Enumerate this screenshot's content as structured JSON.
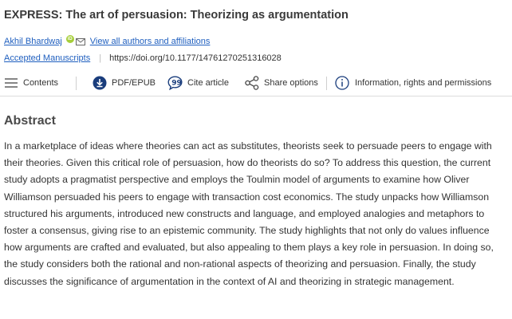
{
  "article": {
    "title": "EXPRESS: The art of persuasion: Theorizing as argumentation",
    "author": "Akhil Bhardwaj",
    "orcid_badge": "iD",
    "all_authors_link": "View all authors and affiliations",
    "status_link": "Accepted Manuscripts",
    "doi": "https://doi.org/10.1177/14761270251316028"
  },
  "toolbar": {
    "contents": "Contents",
    "pdf": "PDF/EPUB",
    "cite": "Cite article",
    "share": "Share options",
    "info": "Information, rights and permissions"
  },
  "abstract": {
    "heading": "Abstract",
    "body": "In a marketplace of ideas where theories can act as substitutes, theorists seek to persuade peers to engage with their theories. Given this critical role of persuasion, how do theorists do so? To address this question, the current study adopts a pragmatist perspective and employs the Toulmin model of arguments to examine how Oliver Williamson persuaded his peers to engage with transaction cost economics. The study unpacks how Williamson structured his arguments, introduced new constructs and language, and employed analogies and metaphors to foster a consensus, giving rise to an epistemic community. The study highlights that not only do values influence how arguments are crafted and evaluated, but also appealing to them plays a key role in persuasion. In doing so, the study considers both the rational and non-rational aspects of theorizing and persuasion. Finally, the study discusses the significance of argumentation in the context of AI and theorizing in strategic management."
  },
  "icons": {
    "orcid": "orcid-icon",
    "mail": "mail-icon",
    "contents": "list-icon",
    "pdf": "download-icon",
    "cite": "quote-bubble-icon",
    "share": "share-icon",
    "info": "info-icon"
  },
  "colors": {
    "link": "#1f5fbf",
    "orcid": "#a6ce39",
    "pdf_icon": "#1a3d7c"
  }
}
